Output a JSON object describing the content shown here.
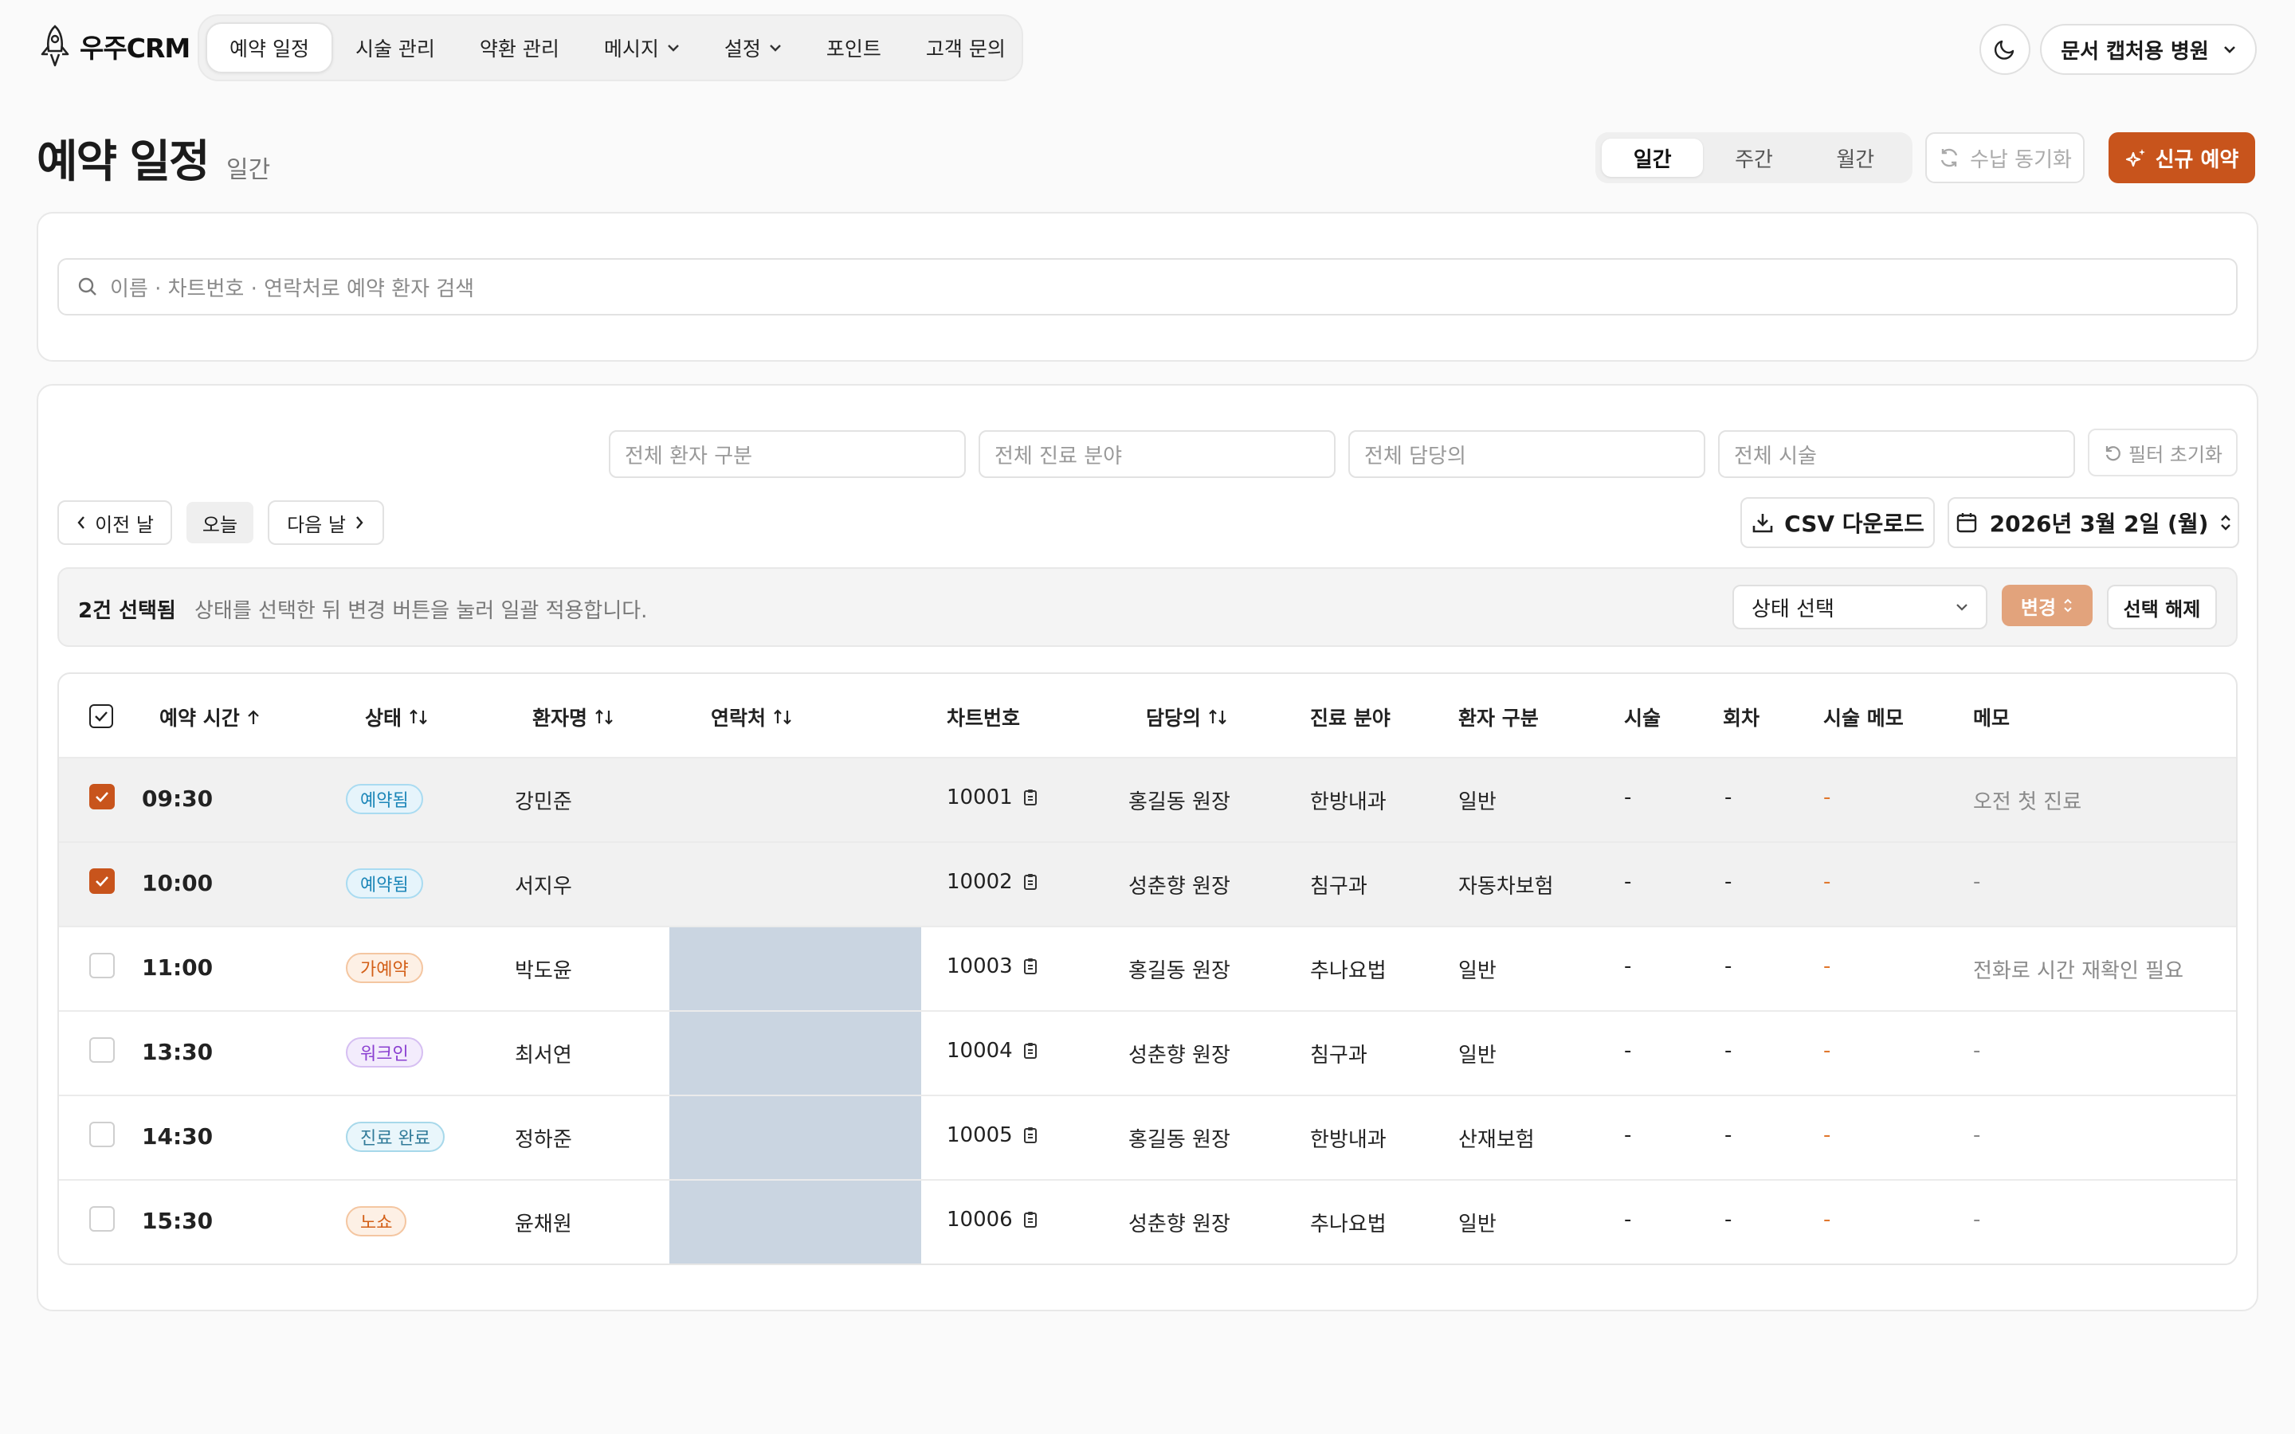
{
  "app": {
    "logo_text": "우주CRM",
    "hospital": "문서 캡처용 병원"
  },
  "nav": {
    "items": [
      {
        "label": "예약 일정"
      },
      {
        "label": "시술 관리"
      },
      {
        "label": "약환 관리"
      },
      {
        "label": "메시지"
      },
      {
        "label": "설정"
      },
      {
        "label": "포인트"
      },
      {
        "label": "고객 문의"
      }
    ]
  },
  "header": {
    "title": "예약 일정",
    "subtitle": "일간",
    "view_tabs": [
      "일간",
      "주간",
      "월간"
    ],
    "sync_label": "수납 동기화",
    "new_label": "신규 예약"
  },
  "search": {
    "placeholder": "이름 · 차트번호 · 연락처로 예약 환자 검색"
  },
  "filters": {
    "patient_type": "전체 환자 구분",
    "department": "전체 진료 분야",
    "doctor": "전체 담당의",
    "procedure": "전체 시술",
    "reset": "필터 초기화"
  },
  "pager": {
    "prev": "이전 날",
    "today": "오늘",
    "next": "다음 날",
    "csv": "CSV 다운로드",
    "date": "2026년 3월 2일 (월)"
  },
  "bulk": {
    "count": "2건 선택됨",
    "desc": "상태를 선택한 뒤 변경 버튼을 눌러 일괄 적용합니다.",
    "status_select": "상태 선택",
    "change": "변경",
    "deselect": "선택 해제"
  },
  "table": {
    "headers": {
      "time": "예약 시간",
      "status": "상태",
      "name": "환자명",
      "contact": "연락처",
      "chart": "차트번호",
      "doctor": "담당의",
      "dept": "진료 분야",
      "ptype": "환자 구분",
      "proc": "시술",
      "round": "회차",
      "proc_memo": "시술 메모",
      "memo": "메모"
    },
    "rows": [
      {
        "time": "09:30",
        "status": "예약됨",
        "name": "강민준",
        "chart": "10001",
        "doctor": "홍길동 원장",
        "dept": "한방내과",
        "ptype": "일반",
        "proc": "-",
        "round": "-",
        "proc_memo": "-",
        "memo": "오전 첫 진료"
      },
      {
        "time": "10:00",
        "status": "예약됨",
        "name": "서지우",
        "chart": "10002",
        "doctor": "성춘향 원장",
        "dept": "침구과",
        "ptype": "자동차보험",
        "proc": "-",
        "round": "-",
        "proc_memo": "-",
        "memo": "-"
      },
      {
        "time": "11:00",
        "status": "가예약",
        "name": "박도윤",
        "chart": "10003",
        "doctor": "홍길동 원장",
        "dept": "추나요법",
        "ptype": "일반",
        "proc": "-",
        "round": "-",
        "proc_memo": "-",
        "memo": "전화로 시간 재확인 필요"
      },
      {
        "time": "13:30",
        "status": "워크인",
        "name": "최서연",
        "chart": "10004",
        "doctor": "성춘향 원장",
        "dept": "침구과",
        "ptype": "일반",
        "proc": "-",
        "round": "-",
        "proc_memo": "-",
        "memo": "-"
      },
      {
        "time": "14:30",
        "status": "진료 완료",
        "name": "정하준",
        "chart": "10005",
        "doctor": "홍길동 원장",
        "dept": "한방내과",
        "ptype": "산재보험",
        "proc": "-",
        "round": "-",
        "proc_memo": "-",
        "memo": "-"
      },
      {
        "time": "15:30",
        "status": "노쇼",
        "name": "윤채원",
        "chart": "10006",
        "doctor": "성춘향 원장",
        "dept": "추나요법",
        "ptype": "일반",
        "proc": "-",
        "round": "-",
        "proc_memo": "-",
        "memo": "-"
      }
    ]
  },
  "colors": {
    "accent": "#c8541c",
    "masked_column": "#cad5e1"
  }
}
